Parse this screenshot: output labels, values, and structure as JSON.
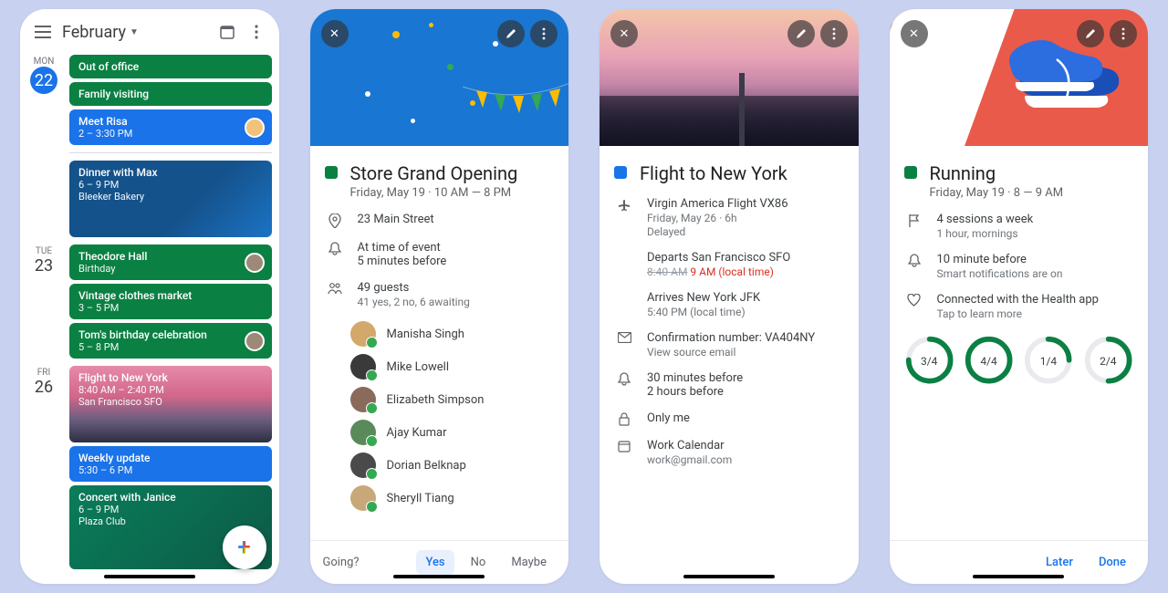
{
  "agenda": {
    "month": "February",
    "days": [
      {
        "dow": "MON",
        "num": "22",
        "today": true,
        "events": [
          {
            "style": "green",
            "t1": "Out of office"
          },
          {
            "style": "green",
            "t1": "Family visiting"
          },
          {
            "style": "blue",
            "t1": "Meet Risa",
            "t2": "2 – 3:30 PM",
            "avatar": "av1"
          },
          {
            "style": "illus1",
            "t1": "Dinner with Max",
            "t2": "6 – 9 PM",
            "t3": "Bleeker Bakery"
          }
        ]
      },
      {
        "dow": "TUE",
        "num": "23",
        "events": [
          {
            "style": "green",
            "t1": "Theodore Hall",
            "t2": "Birthday",
            "avatar": "av2"
          },
          {
            "style": "green",
            "t1": "Vintage clothes market",
            "t2": "3 – 5 PM"
          },
          {
            "style": "green",
            "t1": "Tom's birthday celebration",
            "t2": "5 – 8 PM",
            "avatar": "av2"
          }
        ]
      },
      {
        "dow": "FRI",
        "num": "26",
        "events": [
          {
            "style": "skyline",
            "t1": "Flight to New York",
            "t2": "8:40 AM – 2:40 PM",
            "t3": "San Francisco SFO"
          },
          {
            "style": "blue",
            "t1": "Weekly update",
            "t2": "5:30 – 6 PM"
          },
          {
            "style": "concert",
            "t1": "Concert with Janice",
            "t2": "6 – 9 PM",
            "t3": "Plaza Club"
          }
        ]
      }
    ]
  },
  "event1": {
    "title": "Store Grand Opening",
    "subtitle": "Friday, May 19  ·  10 AM — 8 PM",
    "location": "23 Main Street",
    "reminder1": "At time of event",
    "reminder2": "5 minutes before",
    "guests_line": "49 guests",
    "guests_sub": "41 yes, 2 no, 6 awaiting",
    "guests": [
      "Manisha Singh",
      "Mike Lowell",
      "Elizabeth Simpson",
      "Ajay Kumar",
      "Dorian Belknap",
      "Sheryll Tiang"
    ],
    "rsvp_q": "Going?",
    "rsvp_yes": "Yes",
    "rsvp_no": "No",
    "rsvp_maybe": "Maybe"
  },
  "event2": {
    "title": "Flight to New York",
    "subtitle": "",
    "flight_line": "Virgin America Flight VX86",
    "flight_sub": "Friday, May 26  ·  6h",
    "flight_status": "Delayed",
    "dep_line": "Departs San Francisco SFO",
    "dep_old": "8:40 AM",
    "dep_new": "9 AM (local time)",
    "arr_line": "Arrives New York JFK",
    "arr_sub": "5:40 PM (local time)",
    "conf_line": "Confirmation number: VA404NY",
    "conf_sub": "View source email",
    "rem1": "30 minutes before",
    "rem2": "2 hours before",
    "vis": "Only me",
    "cal": "Work Calendar",
    "cal_sub": "work@gmail.com"
  },
  "event3": {
    "title": "Running",
    "subtitle": "Friday, May 19  ·  8 — 9 AM",
    "goal_line": "4 sessions a week",
    "goal_sub": "1 hour, mornings",
    "rem": "10 minute before",
    "rem_sub": "Smart notifications are on",
    "health": "Connected with the Health app",
    "health_sub": "Tap to learn more",
    "rings": [
      {
        "label": "3/4",
        "pct": 75
      },
      {
        "label": "4/4",
        "pct": 100
      },
      {
        "label": "1/4",
        "pct": 25
      },
      {
        "label": "2/4",
        "pct": 50
      }
    ],
    "later": "Later",
    "done": "Done"
  }
}
